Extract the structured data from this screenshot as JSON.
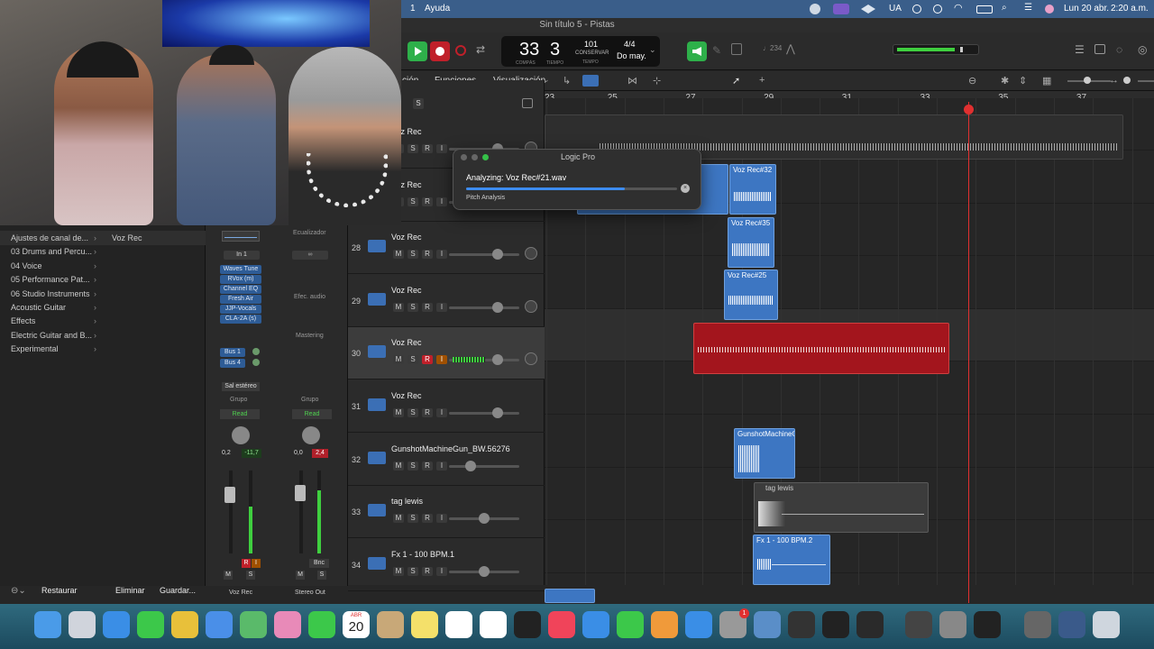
{
  "menubar": {
    "items": [
      "1",
      "Ayuda"
    ],
    "status": [
      "UA",
      "Lun 20 abr.",
      "2:20 a.m."
    ]
  },
  "window": {
    "title": "Sin título 5 - Pistas"
  },
  "lcd": {
    "bar": "33",
    "beat": "3",
    "bar_label": "COMPÁS",
    "beat_label": "TIEMPO",
    "tempo": "101",
    "tempo_label": "CONSERVAR",
    "tempo_sub": "TEMPO",
    "signature": "4/4",
    "key": "Do may."
  },
  "controls": {
    "count": "♩234"
  },
  "toolbar": {
    "menus": [
      "ción",
      "Funciones",
      "Visualización"
    ]
  },
  "ruler": {
    "bars": [
      "23",
      "25",
      "27",
      "29",
      "31",
      "33",
      "35",
      "37"
    ]
  },
  "header_solo": "S",
  "library": {
    "items": [
      "Ajustes de canal de...",
      "03 Drums and Percu...",
      "04 Voice",
      "05 Performance Pat...",
      "06 Studio Instruments",
      "Acoustic Guitar",
      "Effects",
      "Electric Guitar and B...",
      "Experimental"
    ],
    "selected_patch": "Voz Rec",
    "buttons": {
      "restore": "Restaurar",
      "delete": "Eliminar",
      "save": "Guardar..."
    }
  },
  "inspector": {
    "eq_label": "Ecualizador",
    "input": "In 1",
    "fx_audio": "Efec. audio",
    "mastering": "Mastering",
    "plugins": [
      "Waves Tune",
      "RVox (m)",
      "Channel EQ",
      "Fresh Air",
      "JJP-Vocals",
      "CLA-2A (s)"
    ],
    "sends": [
      "Bus 1",
      "Bus 4"
    ],
    "output": "Sal estéreo",
    "group": "Grupo",
    "automation": "Read",
    "ch1": {
      "pan": "0,2",
      "peak": "-11,7",
      "name": "Voz Rec"
    },
    "ch2": {
      "pan": "0,0",
      "peak": "2,4",
      "name": "Stereo Out",
      "bnc": "Bnc"
    },
    "m": "M",
    "s": "S",
    "r": "R",
    "i": "I"
  },
  "tracks": [
    {
      "num": "",
      "name": "Voz Rec"
    },
    {
      "num": "",
      "name": "Voz Rec"
    },
    {
      "num": "28",
      "name": "Voz Rec"
    },
    {
      "num": "29",
      "name": "Voz Rec"
    },
    {
      "num": "30",
      "name": "Voz Rec"
    },
    {
      "num": "31",
      "name": "Voz Rec"
    },
    {
      "num": "32",
      "name": "GunshotMachineGun_BW.56276"
    },
    {
      "num": "33",
      "name": "tag lewis"
    },
    {
      "num": "34",
      "name": "Fx 1 - 100 BPM.1"
    }
  ],
  "msr": {
    "m": "M",
    "s": "S",
    "r": "R",
    "i": "I"
  },
  "regions": {
    "r32": "Voz Rec#32",
    "r35": "Voz Rec#35",
    "r25": "Voz Rec#25",
    "gunshot": "GunshotMachineG",
    "tag": "tag lewis",
    "fx": "Fx 1 - 100 BPM.2"
  },
  "dialog": {
    "title": "Logic Pro",
    "message": "Analyzing: Voz Rec#21.wav",
    "sub": "Pitch Analysis",
    "progress": 0.75
  },
  "dock": {
    "calendar_month": "ABR",
    "calendar_day": "20",
    "badge": "1"
  },
  "colors": {
    "accent": "#3d76c2",
    "record": "#c0202a",
    "selected_region": "#a3151d",
    "playhead": "#e03030",
    "meter": "#3fcf3f"
  }
}
